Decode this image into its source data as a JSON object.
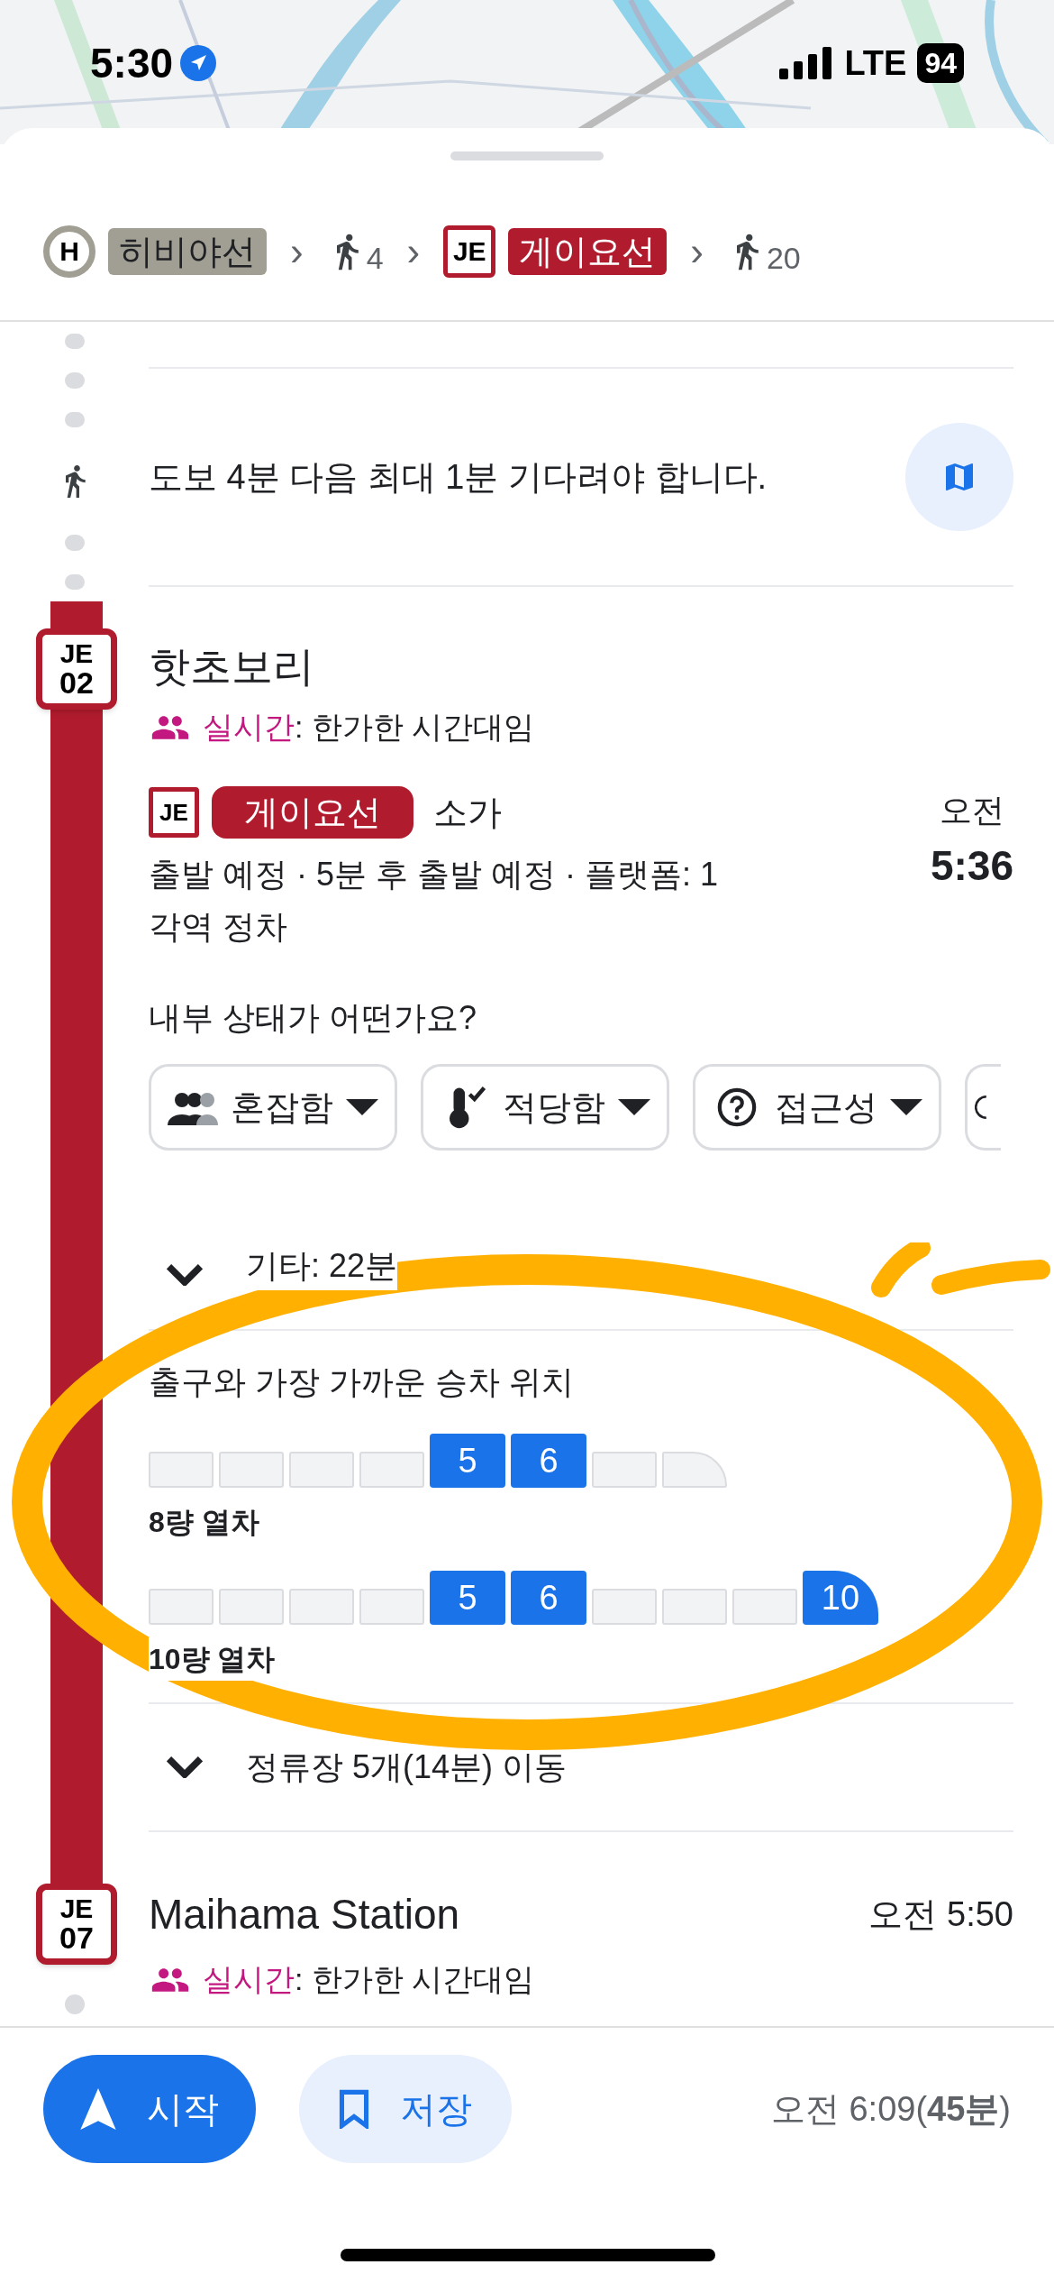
{
  "status_bar": {
    "time": "5:30",
    "network": "LTE",
    "battery": "94"
  },
  "route_summary": [
    {
      "kind": "line",
      "badge": "H",
      "name": "히비야선",
      "color": "#a19f93"
    },
    {
      "kind": "separator",
      "text": "›"
    },
    {
      "kind": "walk",
      "minutes": "4"
    },
    {
      "kind": "separator",
      "text": "›"
    },
    {
      "kind": "line",
      "badge": "JE",
      "name": "게이요선",
      "color": "#b01c2e"
    },
    {
      "kind": "separator",
      "text": "›"
    },
    {
      "kind": "walk",
      "minutes": "20"
    }
  ],
  "walk_step": {
    "text": "도보 4분 다음 최대 1분 기다려야 합니다."
  },
  "departure_stop": {
    "code_line": "JE",
    "code_number": "02",
    "name": "핫초보리",
    "realtime_label": "실시간",
    "realtime_text": ": 한가한 시간대임",
    "line_badge": "JE",
    "line_name": "게이요선",
    "destination": "소가",
    "time_period": "오전",
    "time": "5:36",
    "details": "출발 예정 · 5분 후 출발 예정 · 플랫폼: 1",
    "service": "각역 정차",
    "question": "내부 상태가 어떤가요?",
    "chips": [
      {
        "kind": "crowding",
        "label": "혼잡함"
      },
      {
        "kind": "temperature",
        "label": "적당함"
      },
      {
        "kind": "accessibility",
        "label": "접근성"
      },
      {
        "kind": "partial"
      }
    ],
    "other_departures": "기타: 22분",
    "boarding": {
      "title": "출구와 가장 가까운 승차 위치",
      "trains": [
        {
          "label": "8량 열차",
          "cars": [
            {
              "highlighted": false
            },
            {
              "highlighted": false
            },
            {
              "highlighted": false
            },
            {
              "highlighted": false
            },
            {
              "highlighted": true,
              "label": "5"
            },
            {
              "highlighted": true,
              "label": "6"
            },
            {
              "highlighted": false
            },
            {
              "highlighted": false
            }
          ]
        },
        {
          "label": "10량 열차",
          "cars": [
            {
              "highlighted": false
            },
            {
              "highlighted": false
            },
            {
              "highlighted": false
            },
            {
              "highlighted": false
            },
            {
              "highlighted": true,
              "label": "5"
            },
            {
              "highlighted": true,
              "label": "6"
            },
            {
              "highlighted": false
            },
            {
              "highlighted": false
            },
            {
              "highlighted": false
            },
            {
              "highlighted": true,
              "label": "10"
            }
          ]
        }
      ]
    },
    "stops_summary": "정류장 5개(14분) 이동"
  },
  "arrival_stop": {
    "code_line": "JE",
    "code_number": "07",
    "name": "Maihama Station",
    "time": "오전 5:50",
    "realtime_label": "실시간",
    "realtime_text": ": 한가한 시간대임"
  },
  "bottom_bar": {
    "start_button": "시작",
    "save_button": "저장",
    "arrival": "오전 6:09(**45분**)"
  }
}
